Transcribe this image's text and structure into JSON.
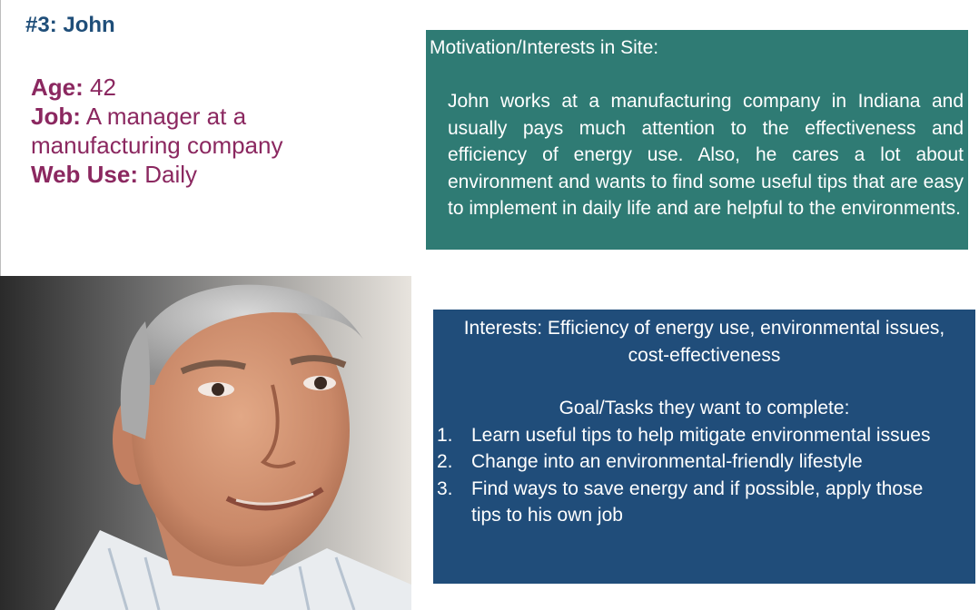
{
  "persona": {
    "title": "#3: John",
    "age_label": "Age:",
    "age_value": "42",
    "job_label": "Job:",
    "job_value": "A manager at a manufacturing company",
    "web_label": "Web Use:",
    "web_value": "Daily"
  },
  "motivation": {
    "heading": "Motivation/Interests in Site:",
    "body": "John works at a manufacturing company in Indiana and usually pays much attention to the effectiveness and efficiency of energy use. Also, he cares a lot about environment and wants to find some useful tips that are easy to implement in daily life and are helpful to the environments."
  },
  "goals": {
    "interests": "Interests: Efficiency of energy use, environmental issues, cost-effectiveness",
    "heading": "Goal/Tasks they want to complete:",
    "items": [
      {
        "num": "1.",
        "text": "Learn useful tips to help mitigate environmental issues"
      },
      {
        "num": "2.",
        "text": "Change into an environmental-friendly lifestyle"
      },
      {
        "num": "3.",
        "text": "Find ways to save energy and if possible, apply those tips to his own job"
      }
    ]
  },
  "colors": {
    "title": "#1f4e79",
    "info_text": "#8b2860",
    "motivation_bg": "#2f7b74",
    "goals_bg": "#204d7a"
  },
  "photo": {
    "icon": "persona-portrait-photo"
  }
}
